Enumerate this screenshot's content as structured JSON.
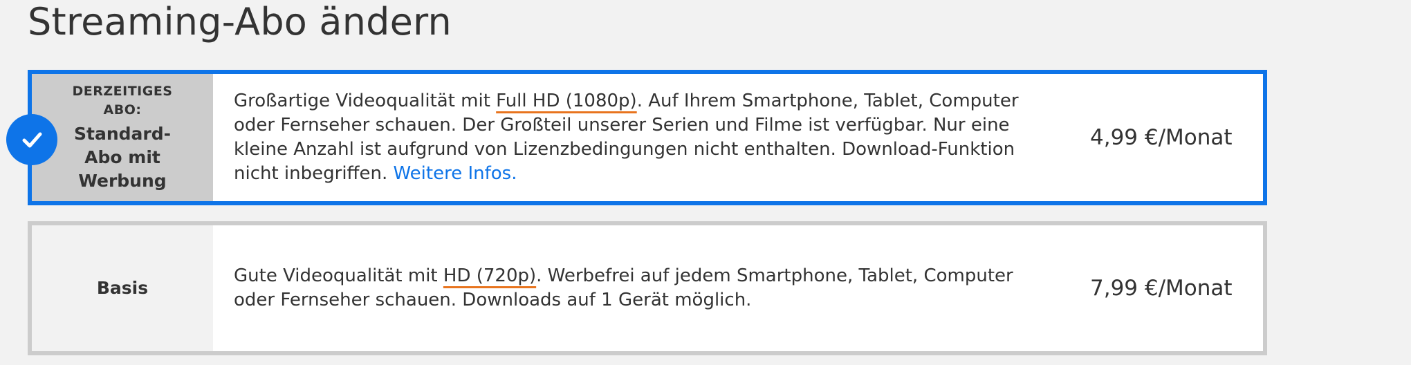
{
  "page": {
    "title": "Streaming-Abo ändern"
  },
  "plans": [
    {
      "current_label": "DERZEITIGES ABO:",
      "name": "Standard-Abo mit Werbung",
      "description_parts": [
        "Großartige Videoqualität mit ",
        "Full HD (1080p)",
        ". Auf Ihrem Smartphone, Tablet, Computer oder Fernseher schauen. Der Großteil unserer Serien und Filme ist verfügbar. Nur eine kleine Anzahl ist aufgrund von Lizenzbedingungen nicht enthalten. Download-Funktion nicht inbegriffen. "
      ],
      "link_label": "Weitere Infos.",
      "price": "4,99 €/Monat",
      "selected": true
    },
    {
      "name": "Basis",
      "description_parts": [
        "Gute Videoqualität mit ",
        "HD (720p)",
        ". Werbefrei auf jedem Smartphone, Tablet, Computer oder Fernseher schauen. Downloads auf 1 Gerät möglich."
      ],
      "price": "7,99 €/Monat",
      "selected": false
    }
  ],
  "icons": {
    "selected_badge": "checkmark-icon"
  },
  "colors": {
    "accent_blue": "#0e74e8",
    "highlight_underline": "#e8741e",
    "current_plan_label_bg": "#cccccc",
    "inactive_border": "#cccccc",
    "page_background": "#f2f2f2"
  }
}
